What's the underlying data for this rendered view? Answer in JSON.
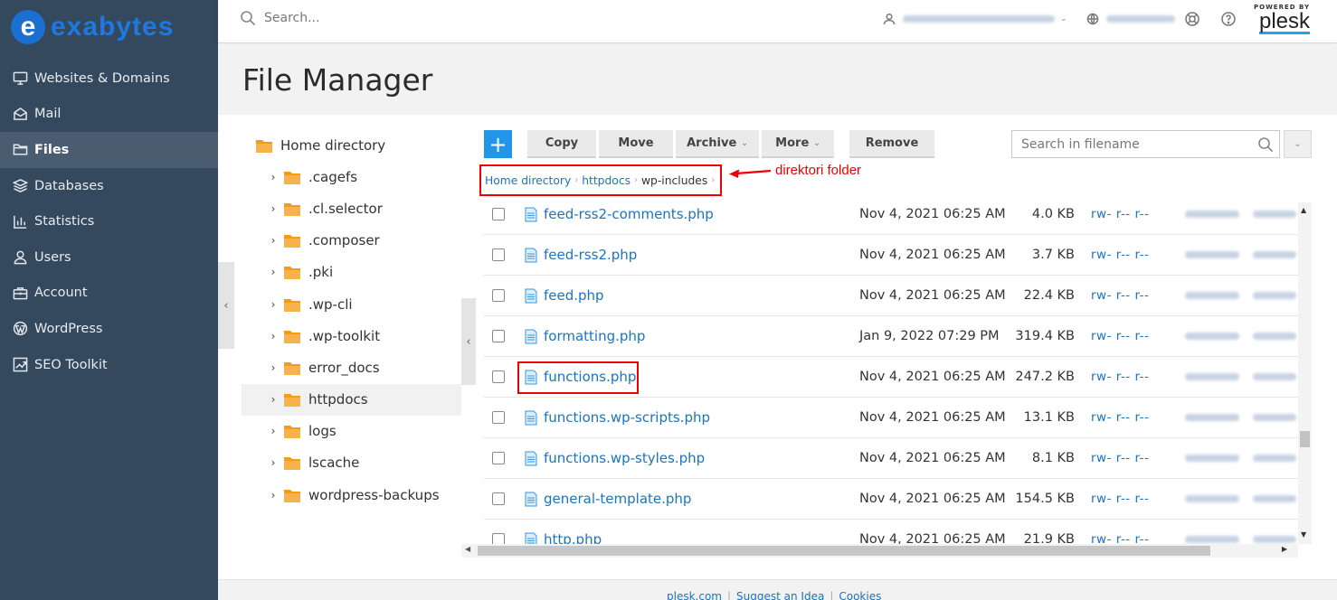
{
  "brand": {
    "logo_letter": "e",
    "logo_text": "exabytes"
  },
  "sidebar": {
    "items": [
      {
        "label": "Websites & Domains",
        "icon": "monitor-icon"
      },
      {
        "label": "Mail",
        "icon": "mail-icon"
      },
      {
        "label": "Files",
        "icon": "folder-icon",
        "active": true
      },
      {
        "label": "Databases",
        "icon": "database-icon"
      },
      {
        "label": "Statistics",
        "icon": "bar-chart-icon"
      },
      {
        "label": "Users",
        "icon": "user-icon"
      },
      {
        "label": "Account",
        "icon": "briefcase-icon"
      },
      {
        "label": "WordPress",
        "icon": "wordpress-icon"
      },
      {
        "label": "SEO Toolkit",
        "icon": "seo-chart-icon"
      }
    ]
  },
  "topbar": {
    "search_placeholder": "Search...",
    "powered_by": "POWERED BY",
    "plesk": "plesk"
  },
  "page": {
    "title": "File Manager"
  },
  "tree": {
    "root": "Home directory",
    "items": [
      ".cagefs",
      ".cl.selector",
      ".composer",
      ".pki",
      ".wp-cli",
      ".wp-toolkit",
      "error_docs",
      "httpdocs",
      "logs",
      "lscache",
      "wordpress-backups"
    ]
  },
  "toolbar": {
    "add": "+",
    "copy": "Copy",
    "move": "Move",
    "archive": "Archive",
    "more": "More",
    "remove": "Remove",
    "filename_search_placeholder": "Search in filename"
  },
  "breadcrumb": {
    "home": "Home directory",
    "httpdocs": "httpdocs",
    "current": "wp-includes"
  },
  "annotation": {
    "text": "direktori folder"
  },
  "files": [
    {
      "name": "feed-rss2-comments.php",
      "date": "Nov 4, 2021 06:25 AM",
      "size": "4.0 KB",
      "perm": "rw- r-- r--"
    },
    {
      "name": "feed-rss2.php",
      "date": "Nov 4, 2021 06:25 AM",
      "size": "3.7 KB",
      "perm": "rw- r-- r--"
    },
    {
      "name": "feed.php",
      "date": "Nov 4, 2021 06:25 AM",
      "size": "22.4 KB",
      "perm": "rw- r-- r--"
    },
    {
      "name": "formatting.php",
      "date": "Jan 9, 2022 07:29 PM",
      "size": "319.4 KB",
      "perm": "rw- r-- r--"
    },
    {
      "name": "functions.php",
      "date": "Nov 4, 2021 06:25 AM",
      "size": "247.2 KB",
      "perm": "rw- r-- r--"
    },
    {
      "name": "functions.wp-scripts.php",
      "date": "Nov 4, 2021 06:25 AM",
      "size": "13.1 KB",
      "perm": "rw- r-- r--"
    },
    {
      "name": "functions.wp-styles.php",
      "date": "Nov 4, 2021 06:25 AM",
      "size": "8.1 KB",
      "perm": "rw- r-- r--"
    },
    {
      "name": "general-template.php",
      "date": "Nov 4, 2021 06:25 AM",
      "size": "154.5 KB",
      "perm": "rw- r-- r--"
    },
    {
      "name": "http.php",
      "date": "Nov 4, 2021 06:25 AM",
      "size": "21.9 KB",
      "perm": "rw- r-- r--"
    }
  ],
  "footer": {
    "links": [
      "plesk.com",
      "Suggest an Idea",
      "Cookies"
    ]
  }
}
